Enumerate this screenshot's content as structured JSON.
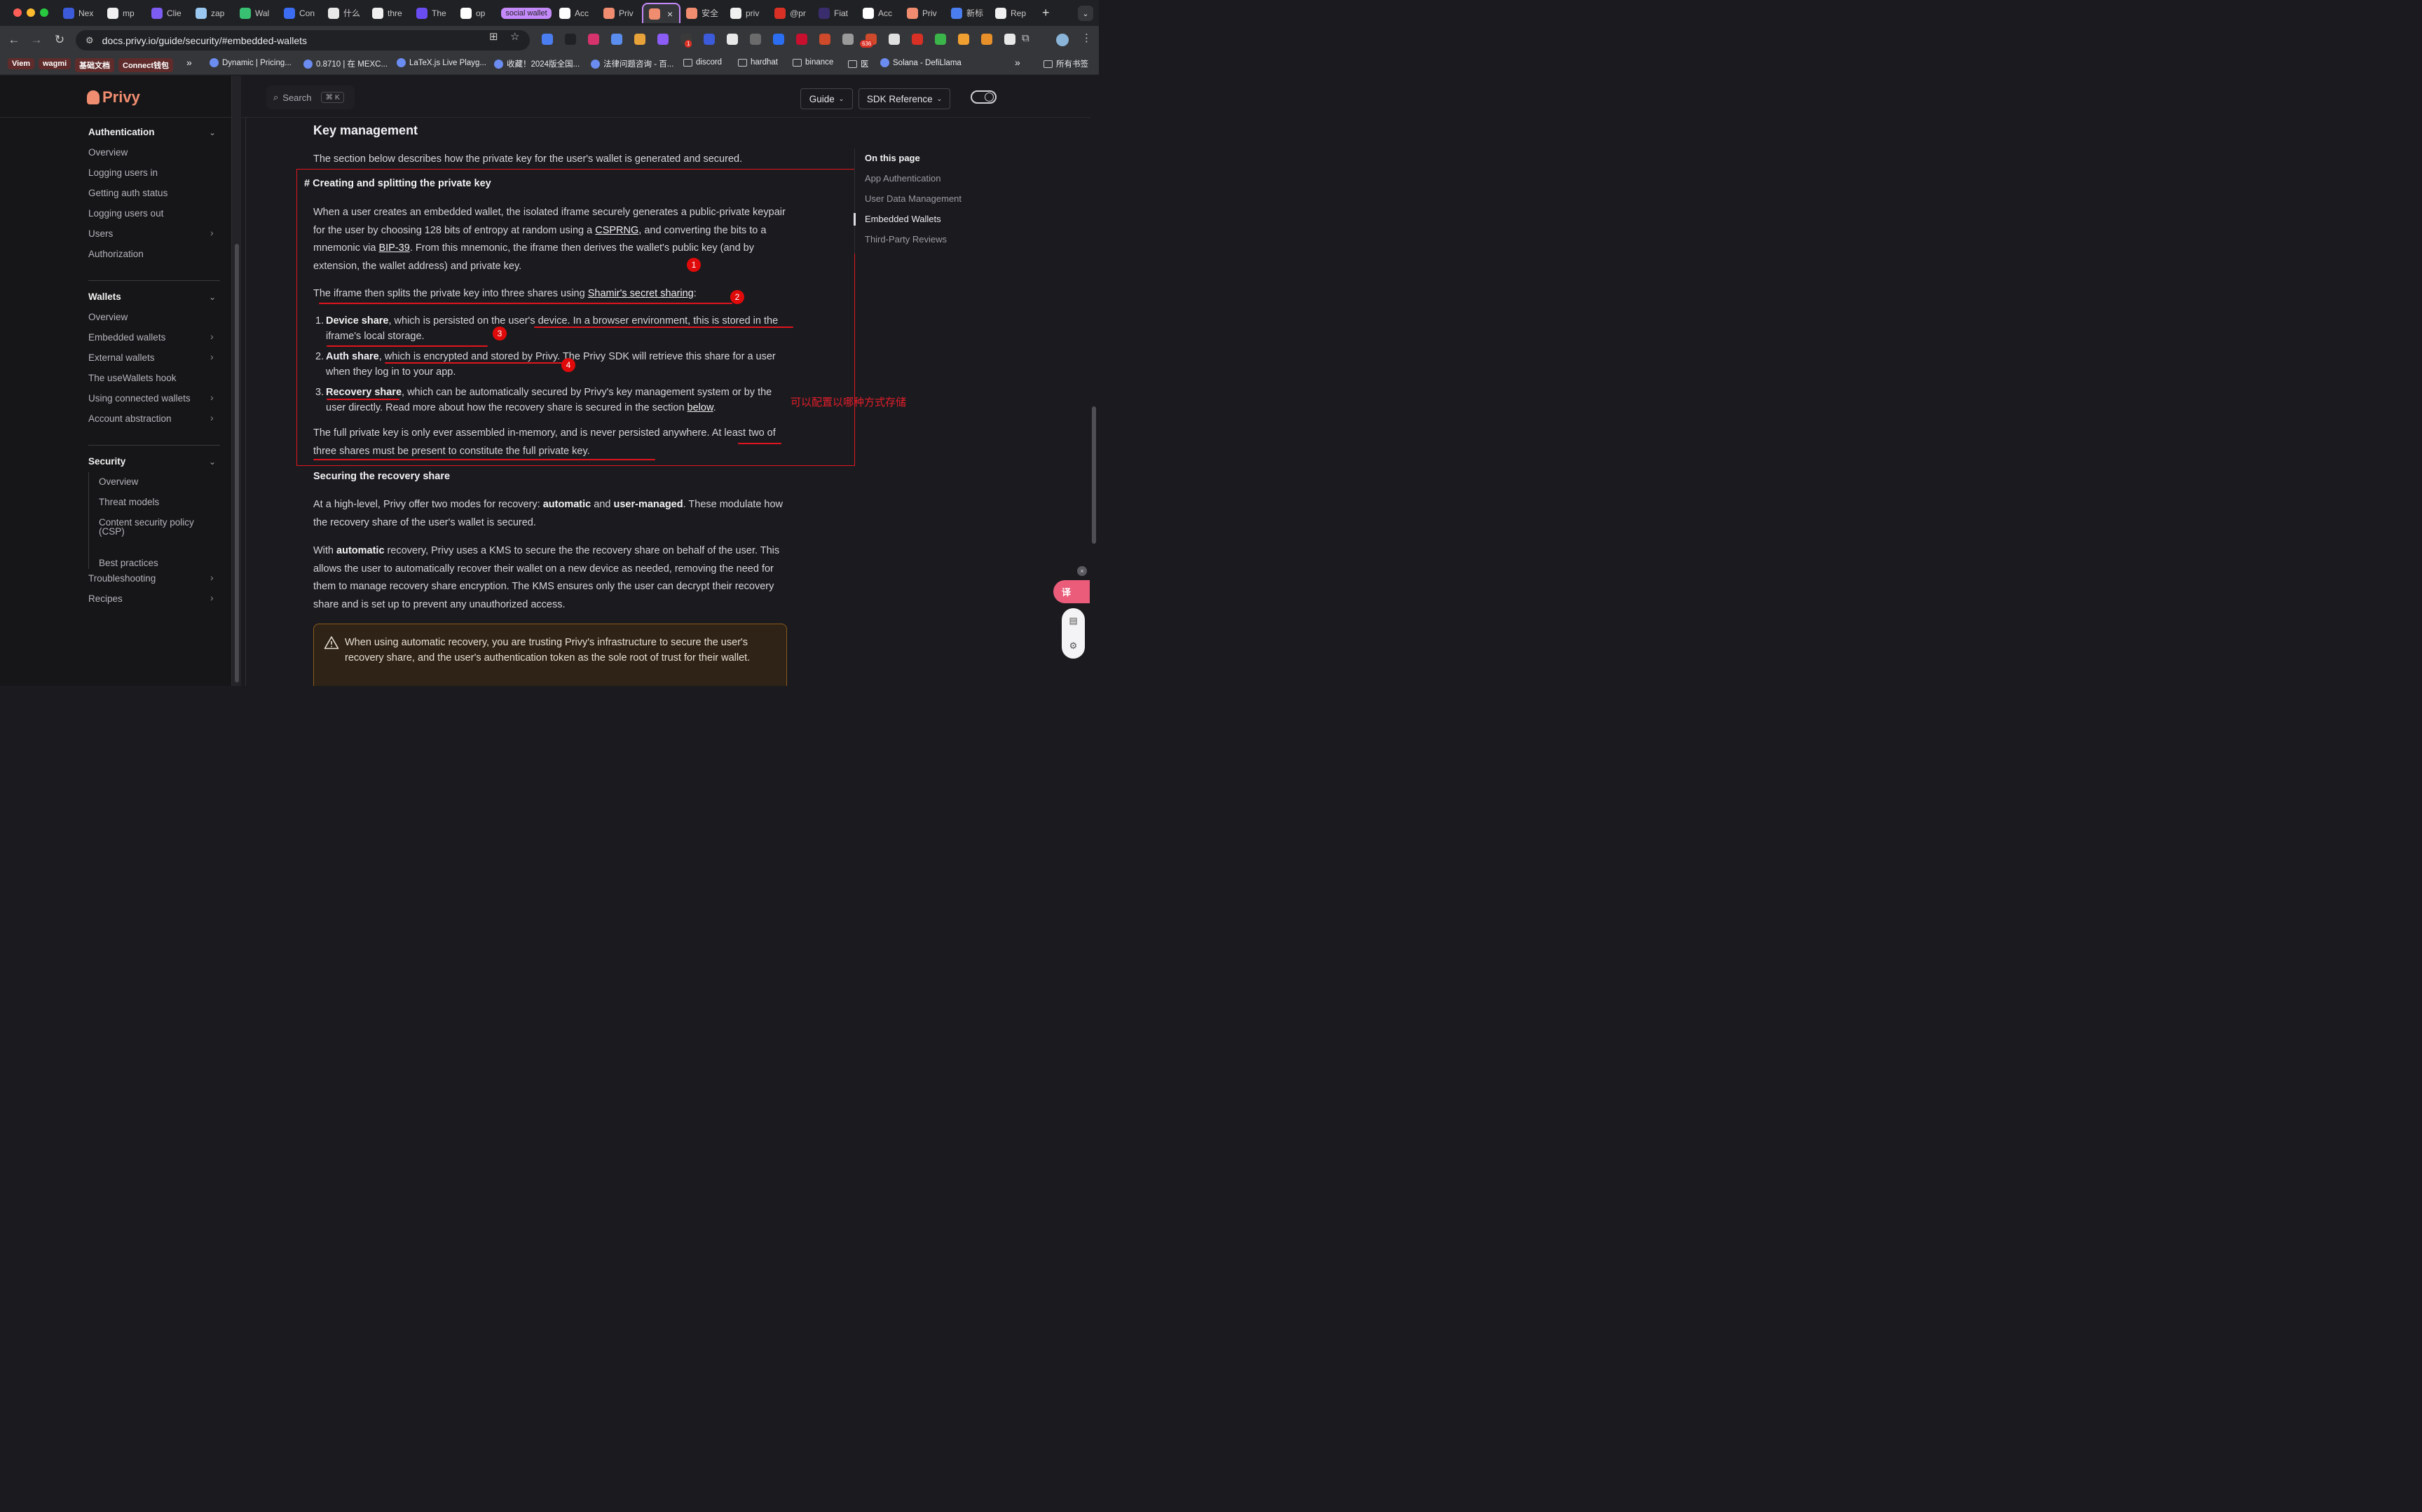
{
  "browser": {
    "tabs": [
      {
        "label": "Nex",
        "icon": "nexus-icon",
        "color": "#3b5bdb"
      },
      {
        "label": "mp",
        "icon": "github-icon",
        "color": "#f0f0f0"
      },
      {
        "label": "Clie",
        "icon": "shield-icon",
        "color": "#7c5cf2"
      },
      {
        "label": "zap",
        "icon": "doc-icon",
        "color": "#9bc8f0"
      },
      {
        "label": "Wal",
        "icon": "book-icon",
        "color": "#38c172"
      },
      {
        "label": "Con",
        "icon": "diamond-icon",
        "color": "#3b6cf2"
      },
      {
        "label": "什么",
        "icon": "x-icon",
        "color": "#e8e8e8"
      },
      {
        "label": "thre",
        "icon": "github-icon",
        "color": "#f0f0f0"
      },
      {
        "label": "The",
        "icon": "globe-icon",
        "color": "#6a4df2"
      },
      {
        "label": "op",
        "icon": "google-icon",
        "color": "#ffffff"
      }
    ],
    "group_label": "social wallet",
    "group_tabs": [
      {
        "label": "Acc",
        "icon": "circle-icon",
        "color": "#ffffff"
      },
      {
        "label": "Priv",
        "icon": "privy-icon",
        "color": "#f08d70"
      }
    ],
    "active_tab": {
      "icon": "privy-icon",
      "color": "#f08d70"
    },
    "tabs_right": [
      {
        "label": "安全",
        "icon": "privy-icon",
        "color": "#f08d70"
      },
      {
        "label": "priv",
        "icon": "github-icon",
        "color": "#f0f0f0"
      },
      {
        "label": "@pr",
        "icon": "bookmark-icon",
        "color": "#d93025"
      },
      {
        "label": "Fiat",
        "icon": "globe-icon",
        "color": "#3a2d6e"
      },
      {
        "label": "Acc",
        "icon": "circle-icon",
        "color": "#ffffff"
      },
      {
        "label": "Priv",
        "icon": "privy-icon",
        "color": "#f08d70"
      },
      {
        "label": "新标",
        "icon": "doc-icon",
        "color": "#4a7ef0"
      },
      {
        "label": "Rep",
        "icon": "github-icon",
        "color": "#f0f0f0"
      }
    ],
    "url": "docs.privy.io/guide/security/#embedded-wallets",
    "extension_badge_1": "1",
    "extension_badge_2": "636",
    "bookmarks": [
      {
        "label": "Viem",
        "type": "chip"
      },
      {
        "label": "wagmi",
        "type": "chip"
      },
      {
        "label": "基础文档",
        "type": "chip"
      },
      {
        "label": "Connect钱包",
        "type": "chip"
      },
      {
        "label": "Dynamic | Pricing...",
        "type": "site"
      },
      {
        "label": "0.8710 | 在 MEXC...",
        "type": "site"
      },
      {
        "label": "LaTeX.js Live Playg...",
        "type": "site"
      },
      {
        "label": "收藏！2024版全国...",
        "type": "site"
      },
      {
        "label": "法律问题咨询 - 百...",
        "type": "site"
      },
      {
        "label": "discord",
        "type": "folder"
      },
      {
        "label": "hardhat",
        "type": "folder"
      },
      {
        "label": "binance",
        "type": "folder"
      },
      {
        "label": "医",
        "type": "folder"
      },
      {
        "label": "Solana - DefiLlama",
        "type": "site"
      },
      {
        "label": "所有书签",
        "type": "folder"
      }
    ],
    "overflow_label": "»"
  },
  "header": {
    "logo": "Privy",
    "search_label": "Search",
    "search_kbd": "⌘ K",
    "guide_label": "Guide",
    "sdk_label": "SDK Reference"
  },
  "sidebar": {
    "sections": [
      {
        "title": "Authentication",
        "items": [
          "Overview",
          "Logging users in",
          "Getting auth status",
          "Logging users out",
          "Users",
          "Authorization"
        ]
      },
      {
        "title": "Wallets",
        "items": [
          "Overview",
          "Embedded wallets",
          "External wallets",
          "The useWallets hook",
          "Using connected wallets",
          "Account abstraction"
        ]
      },
      {
        "title": "Security",
        "items": [
          "Overview",
          "Threat models",
          "Content security policy",
          "(CSP)",
          "Best practices"
        ]
      }
    ],
    "bottom_items": [
      "Troubleshooting",
      "Recipes"
    ]
  },
  "content": {
    "heading": "Key management",
    "intro": "The section below describes how the private key for the user's wallet is generated and secured.",
    "sub_heading_hash": "#",
    "sub_heading": "Creating and splitting the private key",
    "p1": {
      "a": "When a user creates an embedded wallet, the isolated iframe securely generates a public-private keypair for the user by choosing 128 bits of entropy at random using a ",
      "link1": "CSPRNG",
      "b": ", and converting the bits to a mnemonic via ",
      "link2": "BIP-39",
      "c": ". From this mnemonic, the iframe then derives the wallet's public key (and by extension, the wallet address) and private key."
    },
    "p2": {
      "a": "The iframe then splits the private key into three shares using ",
      "link": "Shamir's secret sharing",
      "b": ":"
    },
    "list": [
      {
        "num": "1.",
        "bold": "Device share",
        "text": ", which is persisted on the user's device. In a browser environment, this is stored in the iframe's local storage."
      },
      {
        "num": "2.",
        "bold": "Auth share",
        "text": ", which is encrypted and stored by Privy. The Privy SDK will retrieve this share for a user when they log in to your app."
      },
      {
        "num": "3.",
        "bold": "Recovery share",
        "text": ", which can be automatically secured by Privy's key management system or by the user directly. Read more about how the recovery share is secured in the section ",
        "link": "below",
        "end": "."
      }
    ],
    "p3": "The full private key is only ever assembled in-memory, and is never persisted anywhere. At least two of three shares must be present to constitute the full private key.",
    "recovery_heading": "Securing the recovery share",
    "p4": {
      "a": "At a high-level, Privy offer two modes for recovery: ",
      "b1": "automatic",
      "m": " and ",
      "b2": "user-managed",
      "c": ". These modulate how the recovery share of the user's wallet is secured."
    },
    "p5": {
      "a": "With ",
      "b": "automatic",
      "c": " recovery, Privy uses a KMS to secure the the recovery share on behalf of the user. This allows the user to automatically recover their wallet on a new device as needed, removing the need for them to manage recovery share encryption. The KMS ensures only the user can decrypt their recovery share and is set up to prevent any unauthorized access."
    },
    "warning": "When using automatic recovery, you are trusting Privy's infrastructure to secure the user's recovery share, and the user's authentication token as the sole root of trust for their wallet."
  },
  "annotations": {
    "markers": [
      "1",
      "2",
      "3",
      "4"
    ],
    "note": "可以配置以哪种方式存储",
    "color": "#e0141e"
  },
  "toc": {
    "title": "On this page",
    "items": [
      "App Authentication",
      "User Data Management",
      "Embedded Wallets",
      "Third-Party Reviews"
    ],
    "active": "Embedded Wallets"
  },
  "widgets": {
    "translate_label": "译"
  }
}
